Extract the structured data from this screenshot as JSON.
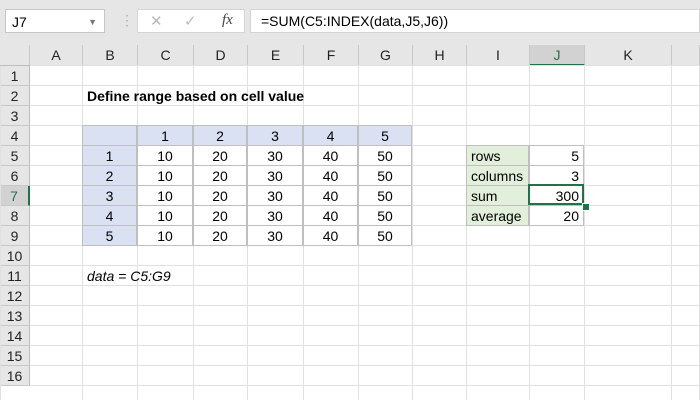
{
  "name_box": "J7",
  "formula_bar": {
    "cancel_icon": "✕",
    "enter_icon": "✓",
    "fx_label": "fx",
    "formula": "=SUM(C5:INDEX(data,J5,J6))"
  },
  "columns": [
    "A",
    "B",
    "C",
    "D",
    "E",
    "F",
    "G",
    "H",
    "I",
    "J",
    "K"
  ],
  "rows": [
    "1",
    "2",
    "3",
    "4",
    "5",
    "6",
    "7",
    "8",
    "9",
    "10",
    "11",
    "12",
    "13",
    "14",
    "15",
    "16"
  ],
  "title": "Define range based on cell value",
  "table": {
    "col_headers": [
      "1",
      "2",
      "3",
      "4",
      "5"
    ],
    "row_headers": [
      "1",
      "2",
      "3",
      "4",
      "5"
    ],
    "values": [
      [
        "10",
        "20",
        "30",
        "40",
        "50"
      ],
      [
        "10",
        "20",
        "30",
        "40",
        "50"
      ],
      [
        "10",
        "20",
        "30",
        "40",
        "50"
      ],
      [
        "10",
        "20",
        "30",
        "40",
        "50"
      ],
      [
        "10",
        "20",
        "30",
        "40",
        "50"
      ]
    ]
  },
  "note": "data = C5:G9",
  "summary": [
    {
      "label": "rows",
      "value": "5"
    },
    {
      "label": "columns",
      "value": "3"
    },
    {
      "label": "sum",
      "value": "300"
    },
    {
      "label": "average",
      "value": "20"
    }
  ],
  "colors": {
    "accent": "#217346",
    "header_fill": "#D9E1F2",
    "label_fill": "#E2EFDA"
  }
}
